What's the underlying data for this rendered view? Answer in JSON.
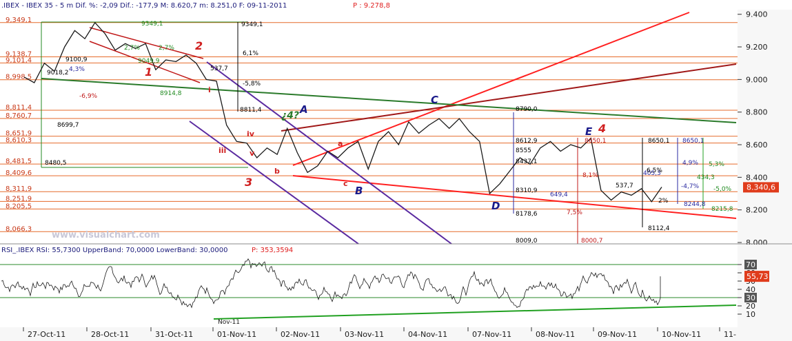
{
  "header": {
    "title": ".IBEX - IBEX 35 -  5 m Dif. %: -2,09 Dif.: -177,9 M: 8.620,7 m: 8.251,0 F: 09-11-2011",
    "pvalue": "P : 9.278,8"
  },
  "chart_data": [
    {
      "type": "line",
      "instrument": "IBEX 35",
      "timeframe": "5 m",
      "ylim": [
        8000,
        9420
      ],
      "yticks": [
        "9.400",
        "9.200",
        "9.000",
        "8.800",
        "8.600",
        "8.400",
        "8.200",
        "8.000"
      ],
      "ytick_values": [
        9400,
        9200,
        9000,
        8800,
        8600,
        8400,
        8200,
        8000
      ],
      "current_price": "8.340,6",
      "current_value": 8340.6,
      "categories": [
        "27-Oct-11",
        "28-Oct-11",
        "31-Oct-11",
        "01-Nov-11",
        "02-Nov-11",
        "03-Nov-11",
        "04-Nov-11",
        "07-Nov-11",
        "08-Nov-11",
        "09-Nov-11",
        "10-Nov-11",
        "11-"
      ],
      "fib_levels": [
        {
          "label": "9,349,1",
          "value": 9349.1
        },
        {
          "label": "9,138,7",
          "value": 9138.7
        },
        {
          "label": "9,101,4",
          "value": 9101.4
        },
        {
          "label": "8,998,5",
          "value": 8998.5
        },
        {
          "label": "8,811,4",
          "value": 8811.4
        },
        {
          "label": "8,760,7",
          "value": 8760.7
        },
        {
          "label": "8,651,9",
          "value": 8651.9
        },
        {
          "label": "8,610,3",
          "value": 8610.3
        },
        {
          "label": "8,481,5",
          "value": 8481.5
        },
        {
          "label": "8,409,6",
          "value": 8409.6
        },
        {
          "label": "8,311,9",
          "value": 8311.9
        },
        {
          "label": "8,251,9",
          "value": 8251.9
        },
        {
          "label": "8,205,5",
          "value": 8205.5
        },
        {
          "label": "8,066,3",
          "value": 8066.3
        }
      ],
      "price_path": [
        [
          0,
          9015
        ],
        [
          1,
          8980
        ],
        [
          2,
          9100
        ],
        [
          3,
          9050
        ],
        [
          4,
          9200
        ],
        [
          5,
          9300
        ],
        [
          6,
          9250
        ],
        [
          7,
          9349
        ],
        [
          8,
          9280
        ],
        [
          9,
          9180
        ],
        [
          10,
          9220
        ],
        [
          11,
          9190
        ],
        [
          12,
          9220
        ],
        [
          13,
          9060
        ],
        [
          14,
          9120
        ],
        [
          15,
          9110
        ],
        [
          16,
          9150
        ],
        [
          17,
          9100
        ],
        [
          18,
          9000
        ],
        [
          19,
          8990
        ],
        [
          20,
          8720
        ],
        [
          21,
          8620
        ],
        [
          22,
          8610
        ],
        [
          23,
          8520
        ],
        [
          24,
          8580
        ],
        [
          25,
          8540
        ],
        [
          26,
          8700
        ],
        [
          27,
          8550
        ],
        [
          28,
          8430
        ],
        [
          29,
          8470
        ],
        [
          30,
          8560
        ],
        [
          31,
          8520
        ],
        [
          32,
          8580
        ],
        [
          33,
          8620
        ],
        [
          34,
          8450
        ],
        [
          35,
          8620
        ],
        [
          36,
          8680
        ],
        [
          37,
          8600
        ],
        [
          38,
          8740
        ],
        [
          39,
          8670
        ],
        [
          40,
          8720
        ],
        [
          41,
          8760
        ],
        [
          42,
          8700
        ],
        [
          43,
          8760
        ],
        [
          44,
          8680
        ],
        [
          45,
          8620
        ],
        [
          46,
          8300
        ],
        [
          47,
          8360
        ],
        [
          48,
          8440
        ],
        [
          49,
          8520
        ],
        [
          50,
          8480
        ],
        [
          51,
          8580
        ],
        [
          52,
          8620
        ],
        [
          53,
          8560
        ],
        [
          54,
          8600
        ],
        [
          55,
          8580
        ],
        [
          56,
          8640
        ],
        [
          57,
          8320
        ],
        [
          58,
          8260
        ],
        [
          59,
          8310
        ],
        [
          60,
          8290
        ],
        [
          61,
          8330
        ],
        [
          62,
          8250
        ],
        [
          63,
          8340
        ]
      ],
      "annotations": [
        "1",
        "2",
        "3",
        "4",
        "A",
        "B",
        "C",
        "D",
        "E",
        "¿4?",
        "a",
        "b",
        "c",
        "i",
        "iii",
        "iv",
        "v",
        "9349,1",
        "9349,1",
        "8811,4",
        "8914,8",
        "8480,5",
        "9018,2",
        "8699,7",
        "9100,9",
        "9049,9",
        "8790,0",
        "8612,9",
        "8555",
        "8437,1",
        "8310,9",
        "8178,6",
        "8009,0",
        "8000,7",
        "8650,1",
        "8650,1",
        "8650,1",
        "8244,8",
        "8215,8",
        "8112,4",
        "537,7",
        "537,7",
        "405,3",
        "649,4",
        "434,3",
        "6,1%",
        "-5,8%",
        "-6,9%",
        "4,3%",
        "2,7%",
        "2,7%",
        "6,5%",
        "4,9%",
        "5,3%",
        "-4,7%",
        "-5,0%",
        "8,1%",
        "7,5%",
        "2%"
      ],
      "watermark": "www.visualchart.com"
    },
    {
      "type": "line",
      "indicator": "RSI",
      "header": "RSI_.IBEX RSI: 55,7300 UpperBand: 70,0000 LowerBand: 30,0000",
      "pvalue": "P: 353,3594",
      "ylim": [
        0,
        80
      ],
      "yticks": [
        "70",
        "30",
        "60",
        "50",
        "40",
        "20",
        "10"
      ],
      "ytick_values": [
        70,
        30,
        60,
        50,
        40,
        20,
        10
      ],
      "current_value": "55,73",
      "upper_band": 70,
      "lower_band": 30,
      "label_nov": "Nov-11"
    }
  ],
  "colors": {
    "fib_line": "#e66a2a",
    "price": "#1a1a1a",
    "red_trend": "#ff2020",
    "dark_red_trend": "#a01818",
    "green_trend": "#2a7a2a",
    "purple_channel": "#5a2aa0",
    "rsi_band": "#2a8a2a",
    "rsi_trend": "#20a020",
    "current_bg": "#e03c1c",
    "axis_bg": "#f7f7f7"
  }
}
